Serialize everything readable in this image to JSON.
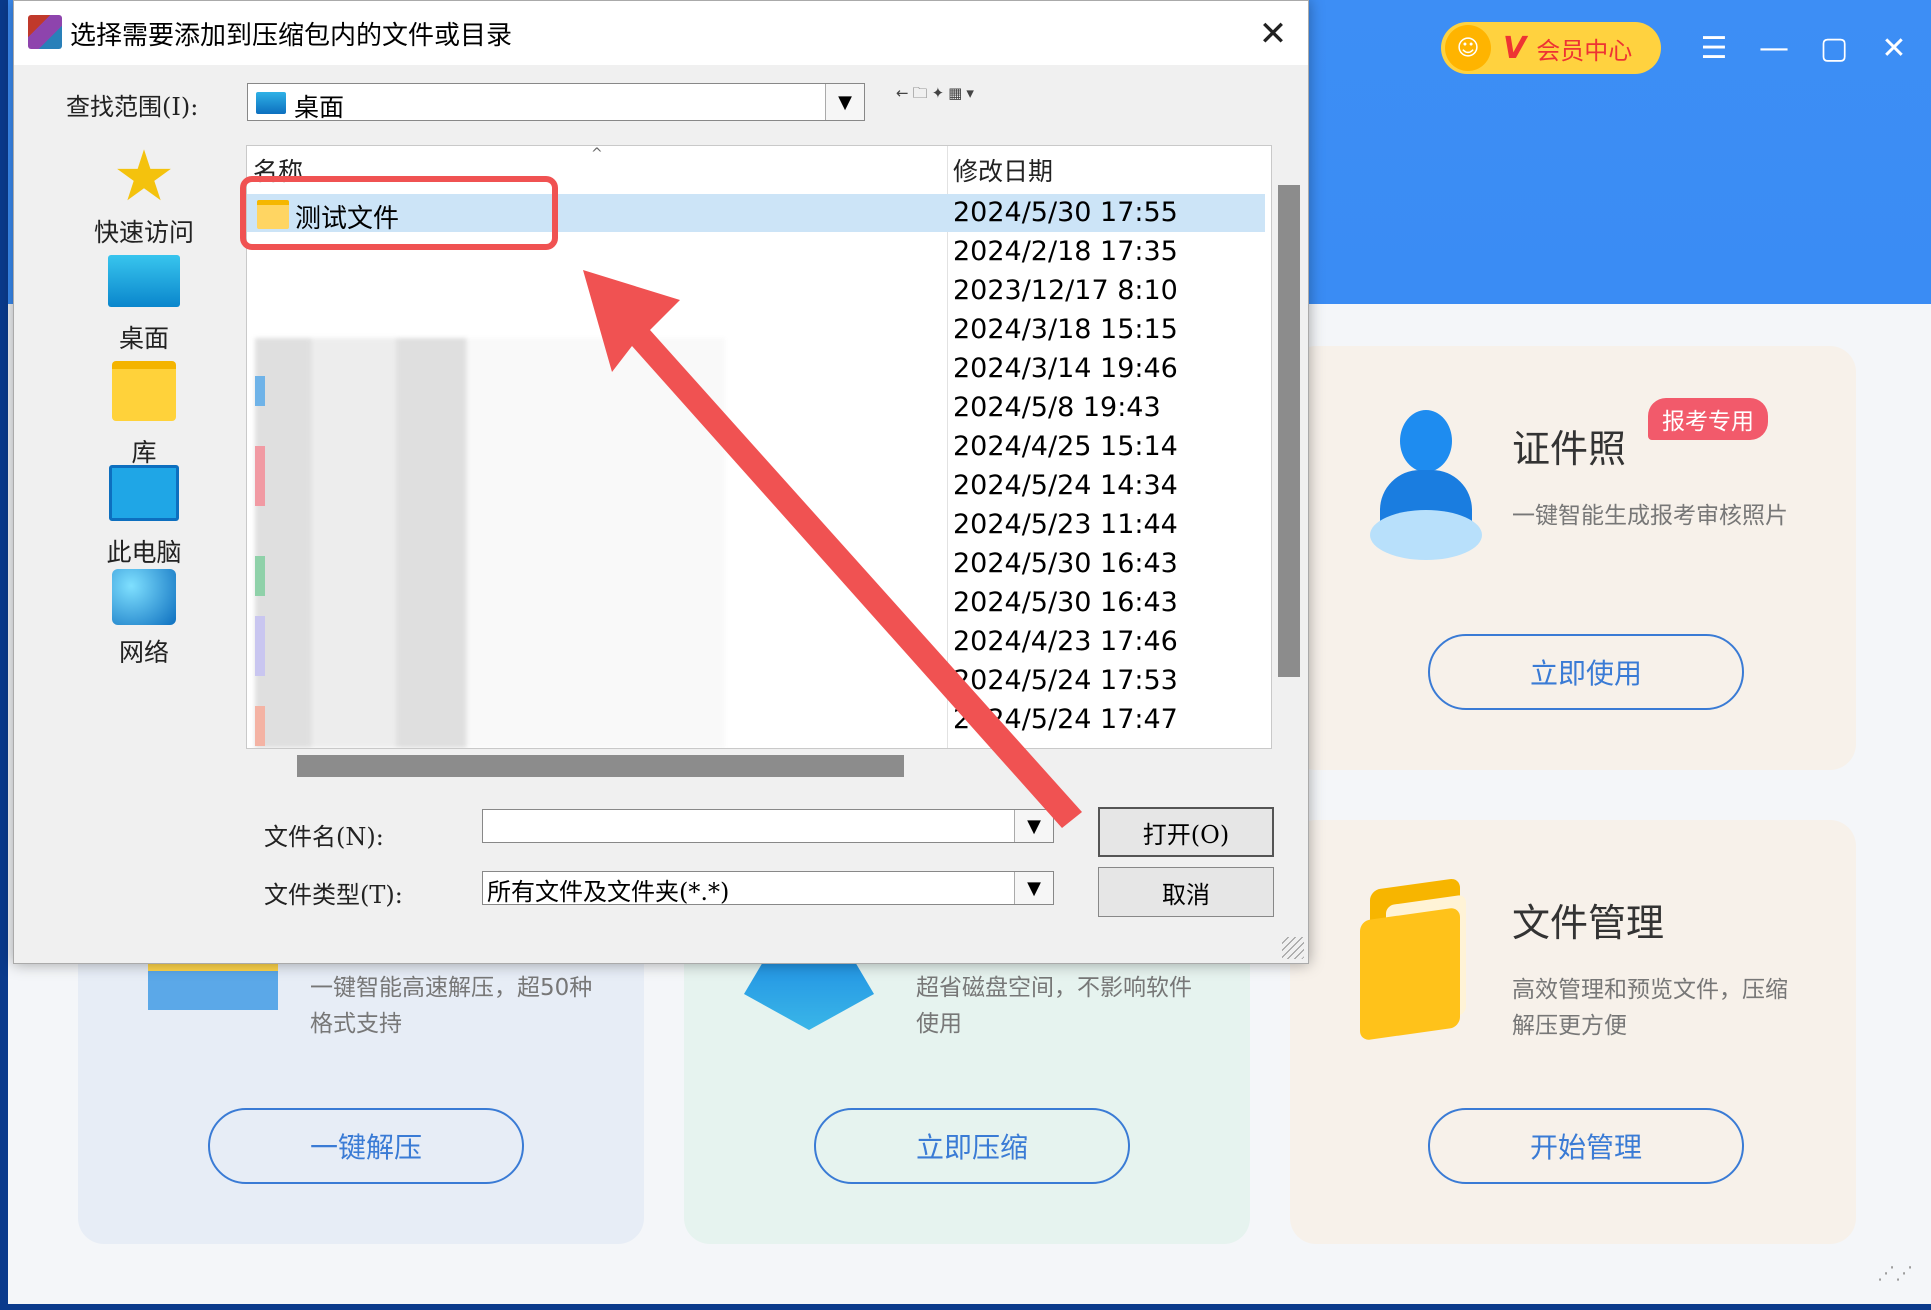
{
  "app": {
    "vip_label": "会员中心",
    "vip_letter": "V",
    "cards": {
      "id_photo": {
        "title": "证件照",
        "badge": "报考专用",
        "desc": "一键智能生成报考审核照片",
        "button": "立即使用"
      },
      "file_manage": {
        "title": "文件管理",
        "desc": "高效管理和预览文件，压缩解压更方便",
        "button": "开始管理"
      },
      "extract": {
        "desc": "一键智能高速解压，超50种格式支持",
        "button": "一键解压"
      },
      "compress": {
        "desc": "超省磁盘空间，不影响软件使用",
        "button": "立即压缩"
      }
    }
  },
  "dialog": {
    "title": "选择需要添加到压缩包内的文件或目录",
    "look_in_label": "查找范围(I):",
    "look_in_value": "桌面",
    "places": [
      "快速访问",
      "桌面",
      "库",
      "此电脑",
      "网络"
    ],
    "columns": {
      "name": "名称",
      "modified": "修改日期"
    },
    "rows": [
      {
        "name": "测试文件",
        "date": "2024/5/30 17:55",
        "selected": true
      },
      {
        "name": "",
        "date": "2024/2/18 17:35"
      },
      {
        "name": "",
        "date": "2023/12/17 8:10"
      },
      {
        "name": "",
        "date": "2024/3/18 15:15"
      },
      {
        "name": "",
        "date": "2024/3/14 19:46"
      },
      {
        "name": "",
        "date": "2024/5/8 19:43"
      },
      {
        "name": "",
        "date": "2024/4/25 15:14"
      },
      {
        "name": "",
        "date": "2024/5/24 14:34"
      },
      {
        "name": "",
        "date": "2024/5/23 11:44"
      },
      {
        "name": "",
        "date": "2024/5/30 16:43"
      },
      {
        "name": "",
        "date": "2024/5/30 16:43"
      },
      {
        "name": "",
        "date": "2024/4/23 17:46"
      },
      {
        "name": "",
        "date": "2024/5/24 17:53"
      },
      {
        "name": "",
        "date": "2024/5/24 17:47"
      }
    ],
    "filename_label": "文件名(N):",
    "filename_value": "",
    "filetype_label": "文件类型(T):",
    "filetype_value": "所有文件及文件夹(*.*)",
    "open_button": "打开(O)",
    "cancel_button": "取消"
  },
  "colors": {
    "header_blue": "#3a8cf4",
    "highlight_red": "#f05252",
    "selection": "#cce4f7",
    "accent": "#3a7bd5"
  }
}
